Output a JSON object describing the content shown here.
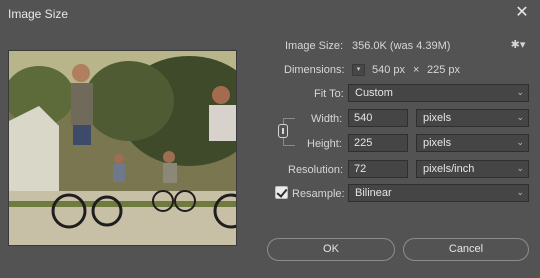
{
  "window": {
    "title": "Image Size"
  },
  "image_size": {
    "label": "Image Size:",
    "value": "356.0K (was 4.39M)"
  },
  "dimensions": {
    "label": "Dimensions:",
    "width_value": "540 px",
    "times": "×",
    "height_value": "225 px"
  },
  "fit_to": {
    "label": "Fit To:",
    "value": "Custom"
  },
  "width": {
    "label": "Width:",
    "value": "540",
    "unit": "pixels"
  },
  "height": {
    "label": "Height:",
    "value": "225",
    "unit": "pixels"
  },
  "resolution": {
    "label": "Resolution:",
    "value": "72",
    "unit": "pixels/inch"
  },
  "resample": {
    "label": "Resample:",
    "value": "Bilinear",
    "checked": true
  },
  "buttons": {
    "ok": "OK",
    "cancel": "Cancel"
  },
  "icons": {
    "close": "close-icon",
    "gear": "gear-icon",
    "dimensions": "dimensions-unit-icon",
    "link": "chain-link-icon",
    "dropdown": "chevron-down-icon"
  },
  "glyphs": {
    "close": "✕",
    "gear": "✱▾",
    "dim": "▾",
    "arrow": "⌄"
  }
}
